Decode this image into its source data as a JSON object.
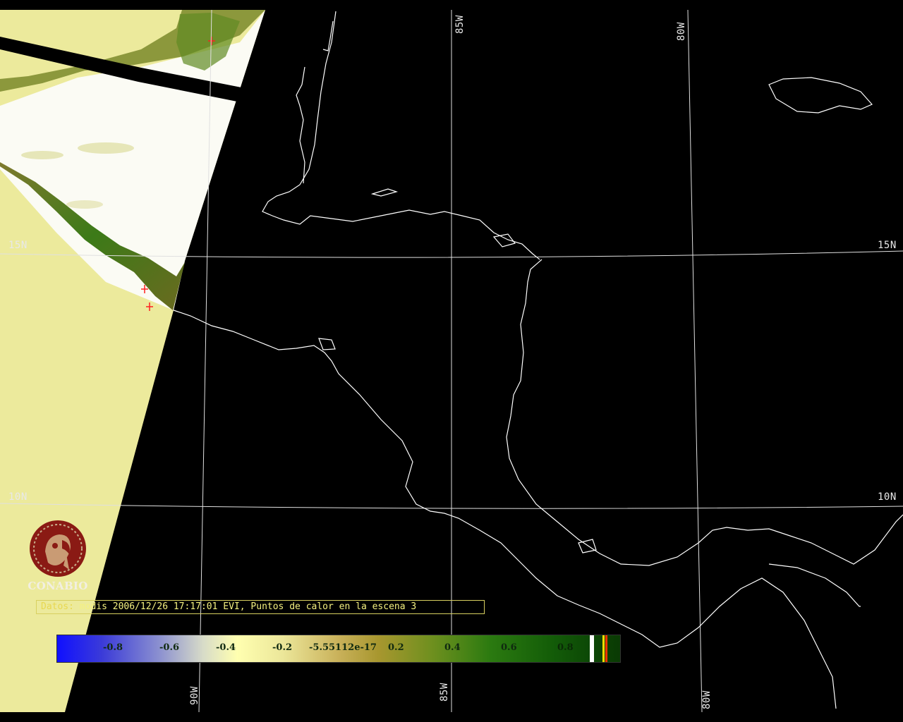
{
  "grid": {
    "lat_labels_left": [
      "15N",
      "10N"
    ],
    "lat_labels_right": [
      "15N",
      "10N"
    ],
    "lon_labels_top": [
      "85W",
      "80W"
    ],
    "lon_labels_bottom": [
      "90W",
      "85W",
      "80W"
    ]
  },
  "logo": {
    "name": "CONABIO"
  },
  "caption": {
    "lead": "Datos:",
    "text": " modis 2006/12/26 17:17:01 EVI, Puntos de calor en la escena 3"
  },
  "colorbar": {
    "labels": [
      "-0.8",
      "-0.6",
      "-0.4",
      "-0.2",
      "-5.55112e-17",
      "0.2",
      "0.4",
      "0.6",
      "0.8"
    ],
    "marker_colors": [
      "#ffffff",
      "#ffdd00",
      "#ff3300"
    ]
  },
  "colors": {
    "land_no_data": "#ecea9c",
    "vegetation_dense": "#2a6e10",
    "vegetation_sparse": "#9a9340",
    "coastline": "#ffffff",
    "hotspot": "#ff2020",
    "grid": "#e0e0e0"
  },
  "icons": {
    "logo": "conabio-macaw-icon",
    "hotspot": "fire-hotspot-icon"
  }
}
